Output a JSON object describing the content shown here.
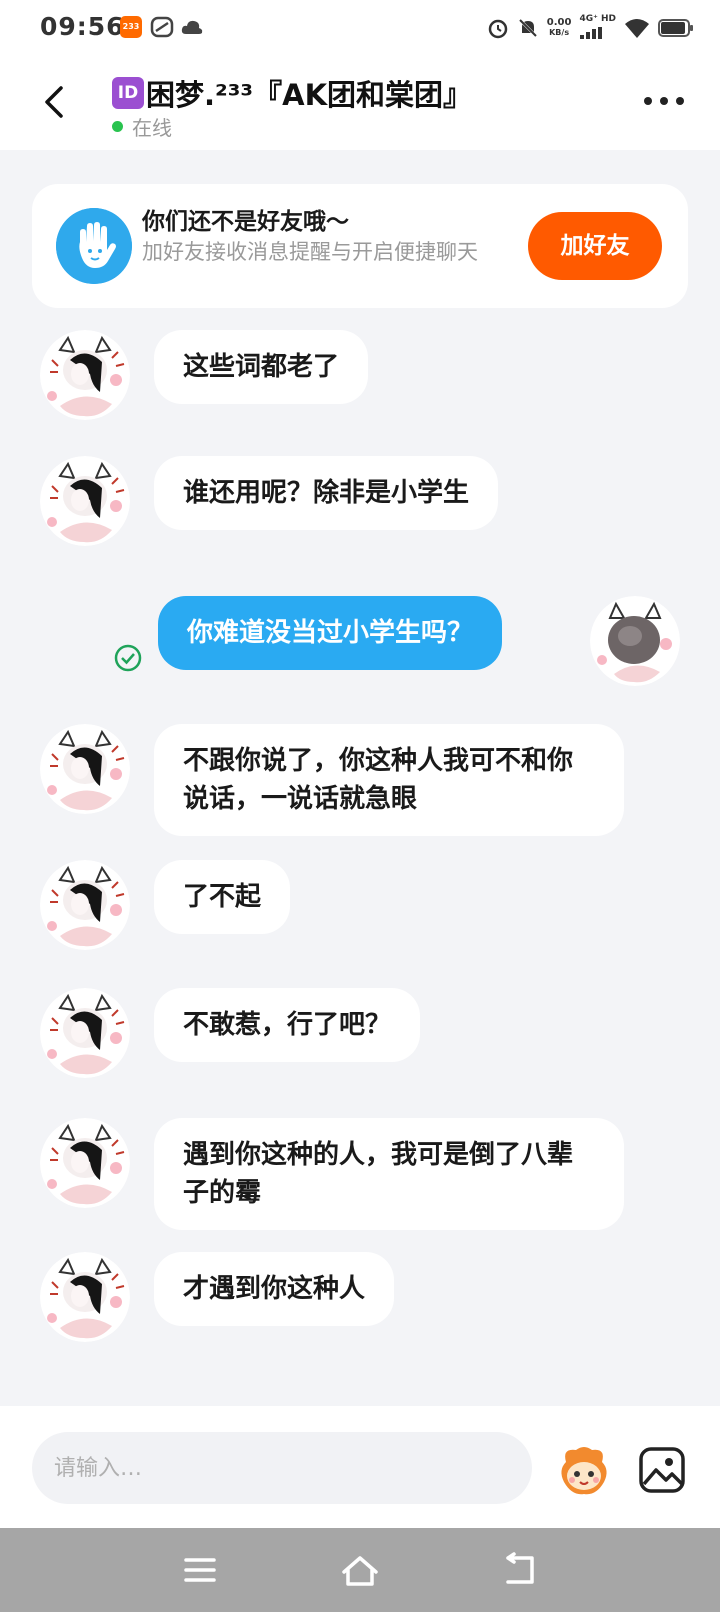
{
  "status_bar": {
    "time": "09:56",
    "notif_badge": "233",
    "speed_value": "0.00",
    "speed_unit": "KB/s",
    "network": "4G⁺",
    "network2": "HD",
    "icons": [
      "alarm-icon",
      "mute-icon",
      "signal-icon",
      "wifi-icon",
      "battery-icon"
    ]
  },
  "header": {
    "id_badge": "ID",
    "title": "困梦.²³³『AK团和棠团』",
    "status": "在线",
    "status_color": "#29c34f"
  },
  "friend_banner": {
    "title": "你们还不是好友哦～",
    "subtitle": "加好友接收消息提醒与开启便捷聊天",
    "button_label": "加好友",
    "button_color": "#ff5a00"
  },
  "messages": [
    {
      "side": "left",
      "text": "这些词都老了"
    },
    {
      "side": "left",
      "text": "谁还用呢？除非是小学生"
    },
    {
      "side": "right",
      "text": "你难道没当过小学生吗？",
      "read": true
    },
    {
      "side": "left",
      "text": "不跟你说了，你这种人我可不和你说话，一说话就急眼"
    },
    {
      "side": "left",
      "text": "了不起"
    },
    {
      "side": "left",
      "text": "不敢惹，行了吧？"
    },
    {
      "side": "left",
      "text": "遇到你这种的人，我可是倒了八辈子的霉"
    },
    {
      "side": "left",
      "text": "才遇到你这种人"
    }
  ],
  "input": {
    "placeholder": "请输入…"
  },
  "colors": {
    "accent_blue": "#2aaaf2",
    "background": "#f3f4f7"
  }
}
